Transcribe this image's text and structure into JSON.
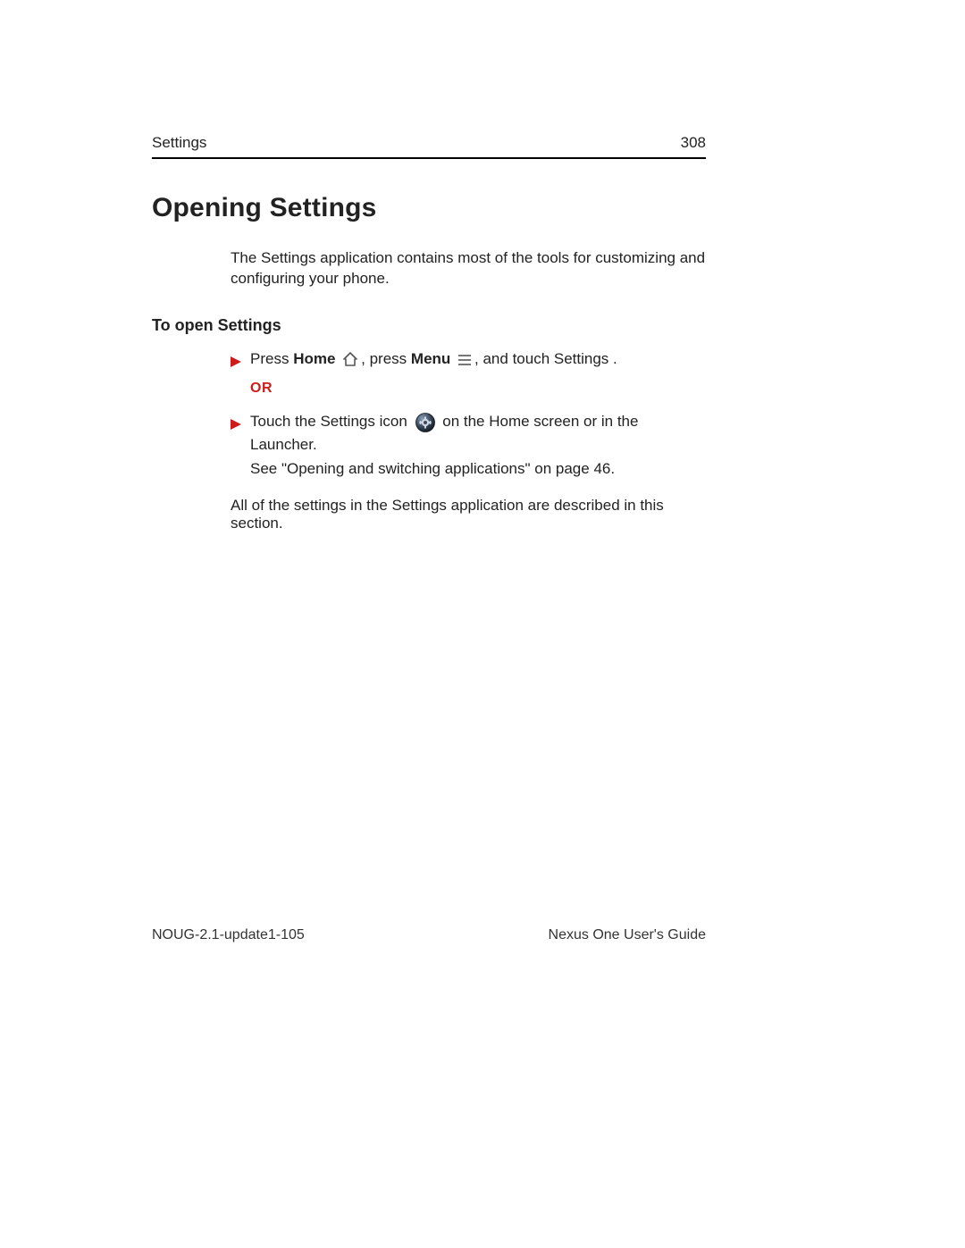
{
  "header": {
    "section": "Settings",
    "page_number": "308"
  },
  "title": "Opening Settings",
  "intro": "The Settings application contains most of the tools for customizing and configuring your phone.",
  "subhead": "To open Settings",
  "step1": {
    "t1": "Press ",
    "home": "Home",
    "t2": ", press ",
    "menu": "Menu",
    "t3": ", and touch ",
    "settings": "Settings",
    "t4": " ."
  },
  "or_label": "OR",
  "step2": {
    "t1": "Touch the Settings icon ",
    "t2": " on the Home screen or in the Launcher."
  },
  "see_line": "See \"Opening and switching applications\" on page 46.",
  "closing": "All of the settings in the Settings application are described in this section.",
  "footer": {
    "left": "NOUG-2.1-update1-105",
    "right": "Nexus One User's Guide"
  }
}
